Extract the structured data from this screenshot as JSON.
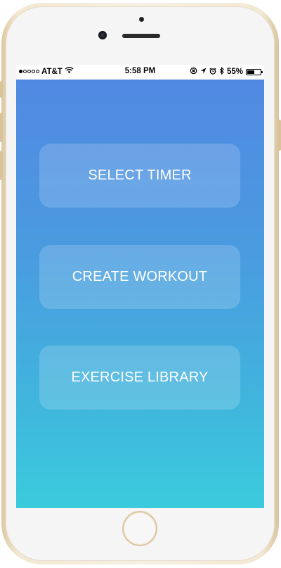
{
  "status_bar": {
    "signal_filled": 1,
    "signal_total": 5,
    "carrier": "AT&T",
    "wifi_icon": "wifi-icon",
    "time": "5:58 PM",
    "icons": [
      "orientation-lock-icon",
      "location-arrow-icon",
      "alarm-icon",
      "bluetooth-icon"
    ],
    "battery_percent": "55%",
    "battery_level": 0.55
  },
  "menu": {
    "buttons": [
      {
        "label": "SELECT TIMER"
      },
      {
        "label": "CREATE WORKOUT"
      },
      {
        "label": "EXERCISE LIBRARY"
      }
    ]
  },
  "colors": {
    "gradient_top": "#5189e2",
    "gradient_bottom": "#3bcbdd",
    "phone_frame": "#f3e8d2",
    "button_text": "#ffffff"
  }
}
